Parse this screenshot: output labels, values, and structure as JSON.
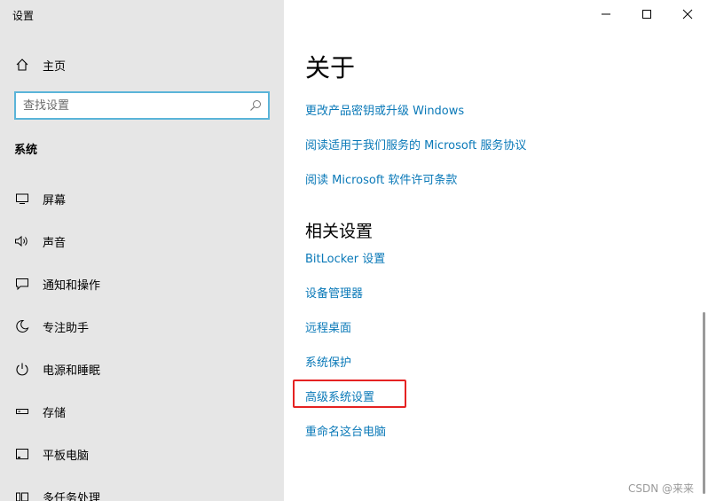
{
  "window": {
    "title": "设置"
  },
  "sidebar": {
    "home_label": "主页",
    "search_placeholder": "查找设置",
    "section_title": "系统",
    "items": [
      {
        "label": "屏幕",
        "icon": "monitor-icon"
      },
      {
        "label": "声音",
        "icon": "speaker-icon"
      },
      {
        "label": "通知和操作",
        "icon": "notification-icon"
      },
      {
        "label": "专注助手",
        "icon": "moon-icon"
      },
      {
        "label": "电源和睡眠",
        "icon": "power-icon"
      },
      {
        "label": "存储",
        "icon": "storage-icon"
      },
      {
        "label": "平板电脑",
        "icon": "tablet-icon"
      },
      {
        "label": "多任务处理",
        "icon": "multitask-icon"
      }
    ]
  },
  "main": {
    "title": "关于",
    "top_links": [
      "更改产品密钥或升级 Windows",
      "阅读适用于我们服务的 Microsoft 服务协议",
      "阅读 Microsoft 软件许可条款"
    ],
    "related_title": "相关设置",
    "related_links": [
      "BitLocker 设置",
      "设备管理器",
      "远程桌面",
      "系统保护",
      "高级系统设置",
      "重命名这台电脑"
    ],
    "highlighted_link": "高级系统设置"
  },
  "colors": {
    "link": "#0a79b8",
    "sidebar_bg": "#e6e6e6",
    "highlight": "#e52222",
    "search_border": "#5ab4d9"
  },
  "watermark": "CSDN @来来"
}
